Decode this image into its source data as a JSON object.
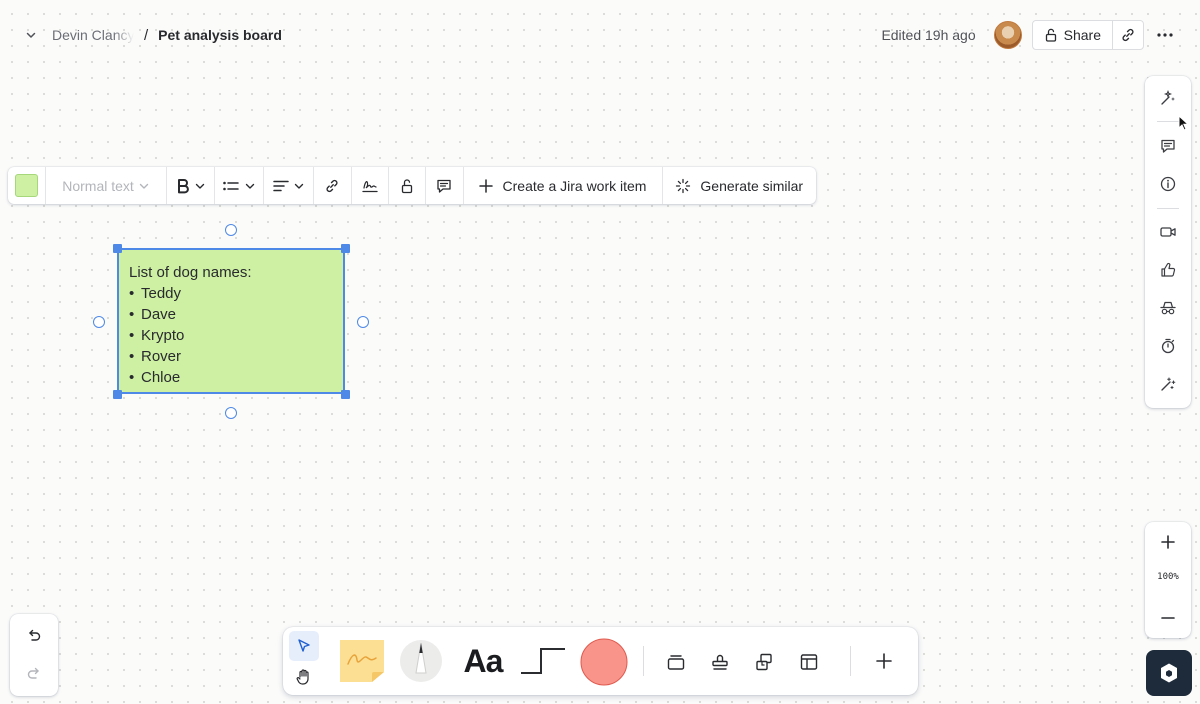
{
  "header": {
    "owner": "Devin Clancy",
    "separator": "/",
    "board_title": "Pet analysis board",
    "edited": "Edited 19h ago",
    "share_label": "Share"
  },
  "format_toolbar": {
    "text_style": "Normal text",
    "jira_label": "Create a Jira work item",
    "generate_label": "Generate similar",
    "note_color": "#cdf0a3"
  },
  "sticky_note": {
    "heading": "List of dog names:",
    "items": [
      "Teddy",
      "Dave",
      "Krypto",
      "Rover",
      "Chloe"
    ]
  },
  "zoom": {
    "level": "100%"
  },
  "colors": {
    "selection": "#4e89e8",
    "shape_fill": "#f9948b",
    "sticky_fill": "#fcdf93",
    "accent": "#1f5fd1"
  }
}
